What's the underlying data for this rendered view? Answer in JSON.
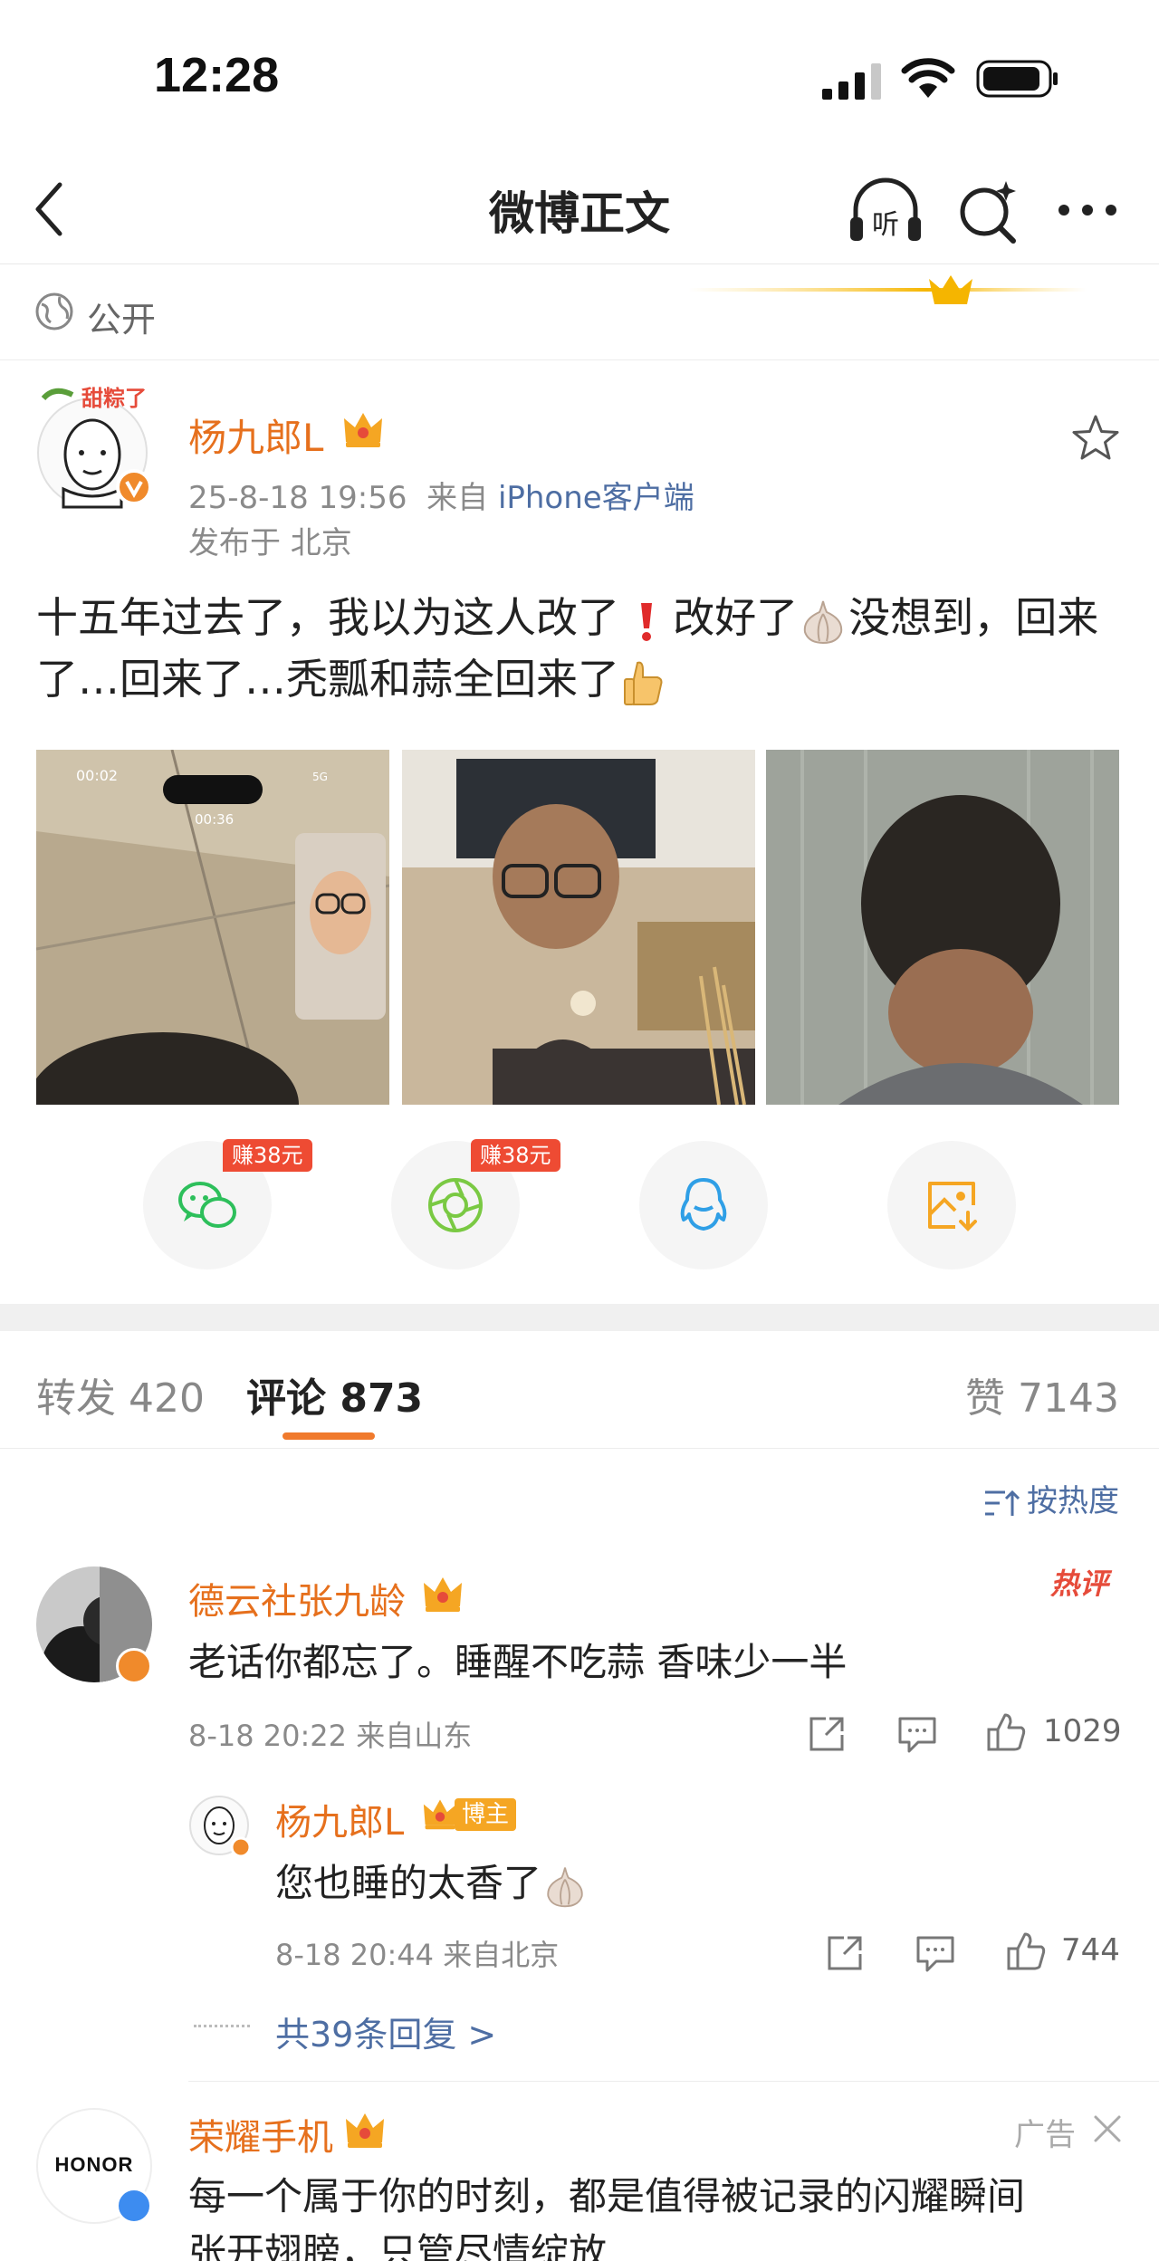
{
  "status_bar": {
    "time": "12:28"
  },
  "nav": {
    "title": "微博正文",
    "listen_label": "听"
  },
  "visibility": {
    "label": "公开"
  },
  "post": {
    "author": "杨九郎L",
    "date": "25-8-18 19:56",
    "source_prefix": "来自",
    "source": "iPhone客户端",
    "location": "发布于 北京",
    "text_part1": "十五年过去了，我以为这人改了",
    "text_part2": "改好了",
    "text_part3": "没想到，回来了…回来了…秃瓢和蒜全回来了",
    "photos": [
      {
        "status_time": "00:02",
        "call_time": "00:36",
        "network": "5G"
      },
      {},
      {}
    ]
  },
  "share": {
    "earn_badge": "赚38元",
    "buttons": [
      "wechat",
      "moments",
      "qq",
      "save-image"
    ]
  },
  "tabs": {
    "repost_label": "转发",
    "repost_count": "420",
    "comments_label": "评论",
    "comments_count": "873",
    "likes_label": "赞",
    "likes_count": "7143"
  },
  "sort": {
    "label": "按热度"
  },
  "comments": [
    {
      "name": "德云社张九龄",
      "hot_label": "热评",
      "text": "老话你都忘了。睡醒不吃蒜 香味少一半",
      "meta": "8-18 20:22 来自山东",
      "likes": "1029",
      "reply": {
        "name": "杨九郎L",
        "tag": "博主",
        "text": "您也睡的太香了",
        "meta": "8-18 20:44 来自北京",
        "likes": "744"
      },
      "more_replies": "共39条回复 >"
    }
  ],
  "ad": {
    "logo": "HONOR",
    "name": "荣耀手机",
    "label": "广告",
    "line1": "每一个属于你的时刻，都是值得被记录的闪耀瞬间",
    "line2": "张开翅膀，只管尽情绽放"
  },
  "colors": {
    "accent_orange": "#e6701d",
    "link_blue": "#4e6ea3",
    "earn_red": "#ee4b33",
    "wechat_green": "#2dbf5b",
    "qq_blue": "#2f9fe6",
    "save_orange": "#f5a623"
  }
}
